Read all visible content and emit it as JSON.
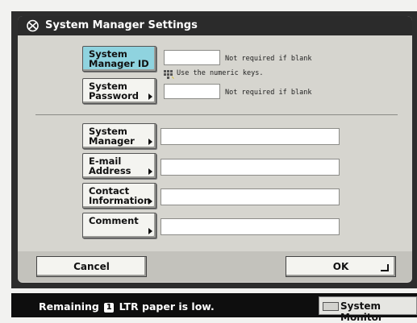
{
  "window": {
    "title": "System Manager Settings"
  },
  "fields": {
    "system_manager_id": {
      "label": "System\nManager ID",
      "value": "",
      "note": "Not required if blank",
      "hint": "Use the numeric keys."
    },
    "system_password": {
      "label": "System\nPassword",
      "value": "",
      "note": "Not required if blank"
    },
    "system_manager": {
      "label": "System\nManager",
      "value": ""
    },
    "email_address": {
      "label": "E-mail\nAddress",
      "value": ""
    },
    "contact_information": {
      "label": "Contact\nInformation",
      "value": ""
    },
    "comment": {
      "label": "Comment",
      "value": ""
    }
  },
  "footer": {
    "cancel_label": "Cancel",
    "ok_label": "OK"
  },
  "status": {
    "prefix": "Remaining",
    "tray": "1",
    "suffix": "LTR paper is low."
  },
  "system_monitor": {
    "label": "System Monitor"
  },
  "colors": {
    "active_button": "#8fd3df",
    "title_bar": "#2b2b2b",
    "panel": "#d6d5cf"
  }
}
